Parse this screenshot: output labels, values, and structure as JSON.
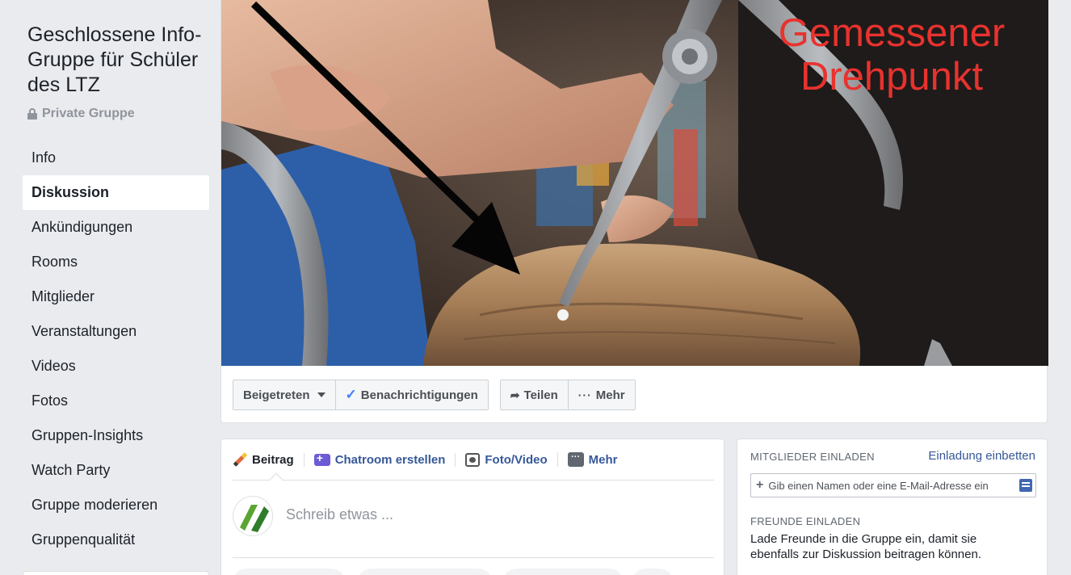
{
  "group": {
    "title": "Geschlossene Info-Gruppe für Schüler des LTZ",
    "privacy": "Private Gruppe"
  },
  "nav": {
    "items": [
      {
        "label": "Info"
      },
      {
        "label": "Diskussion",
        "active": true
      },
      {
        "label": "Ankündigungen"
      },
      {
        "label": "Rooms"
      },
      {
        "label": "Mitglieder"
      },
      {
        "label": "Veranstaltungen"
      },
      {
        "label": "Videos"
      },
      {
        "label": "Fotos"
      },
      {
        "label": "Gruppen-Insights"
      },
      {
        "label": "Watch Party"
      },
      {
        "label": "Gruppe moderieren"
      },
      {
        "label": "Gruppenqualität"
      }
    ]
  },
  "cover": {
    "caption_line1": "Gemessener",
    "caption_line2": "Drehpunkt"
  },
  "actions": {
    "joined": "Beigetreten",
    "notifications": "Benachrichtigungen",
    "share": "Teilen",
    "more": "Mehr"
  },
  "composer": {
    "tabs": [
      "Beitrag",
      "Chatroom erstellen",
      "Foto/Video",
      "Mehr"
    ],
    "placeholder": "Schreib etwas ..."
  },
  "invite": {
    "members_heading": "MITGLIEDER EINLADEN",
    "embed_link": "Einladung einbetten",
    "input_placeholder": "Gib einen Namen oder eine E-Mail-Adresse ein",
    "friends_heading": "FREUNDE EINLADEN",
    "friends_text": "Lade Freunde in die Gruppe ein, damit sie ebenfalls zur Diskussion beitragen können."
  },
  "colors": {
    "link": "#365899",
    "caption_red": "#e8322e",
    "check_blue": "#4080ff"
  }
}
